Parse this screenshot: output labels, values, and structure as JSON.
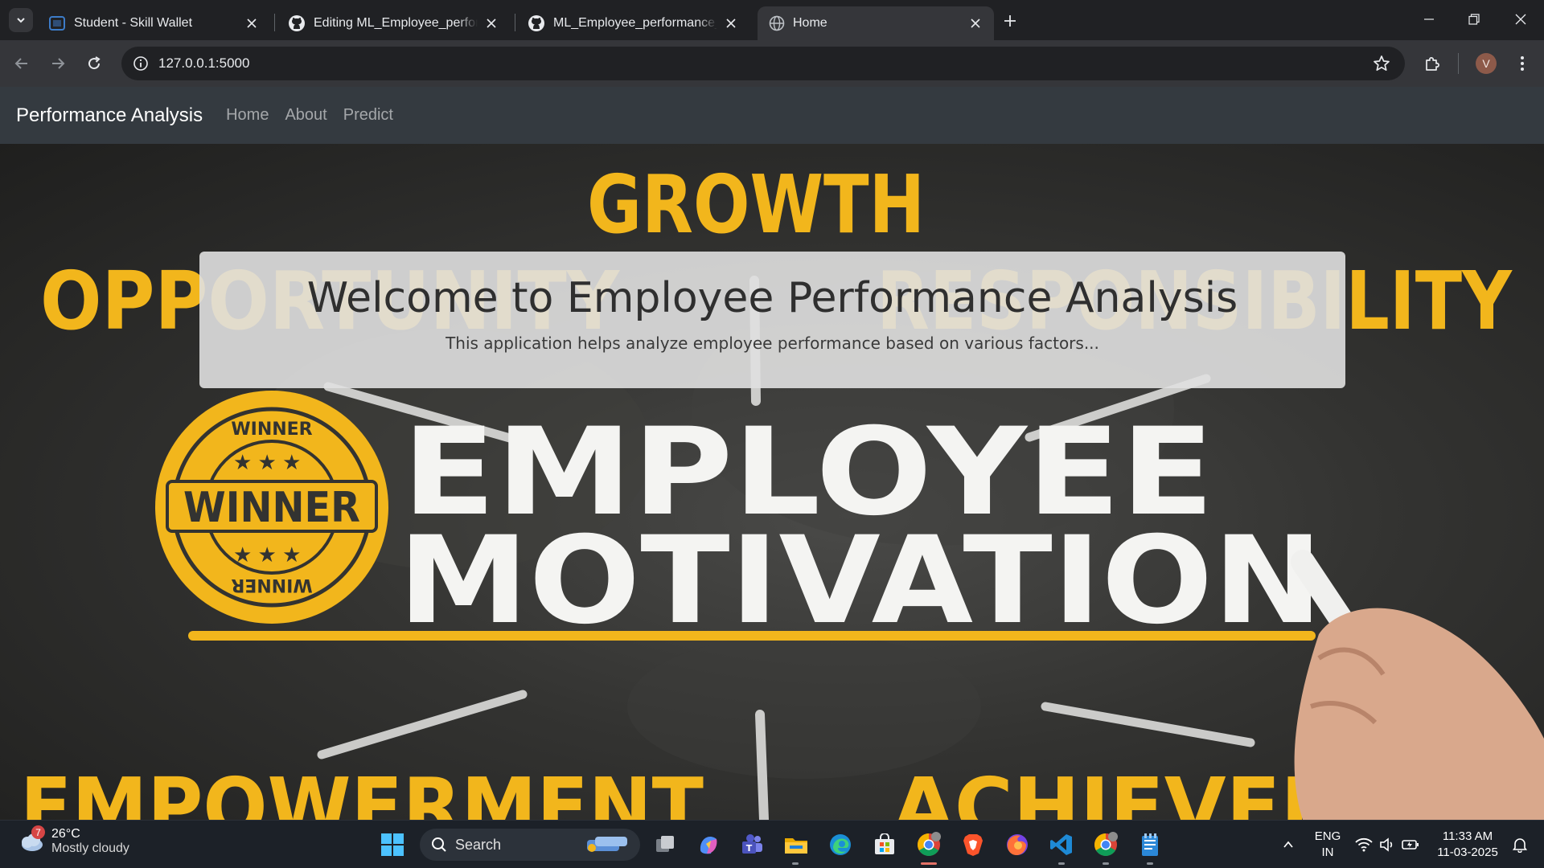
{
  "browser": {
    "tabs": [
      {
        "title": "Student - Skill Wallet",
        "icon": "skill-wallet-icon",
        "active": false
      },
      {
        "title": "Editing ML_Employee_performa",
        "icon": "github-icon",
        "active": false
      },
      {
        "title": "ML_Employee_performance_pre",
        "icon": "github-icon",
        "active": false
      },
      {
        "title": "Home",
        "icon": "globe-icon",
        "active": true
      }
    ],
    "url": "127.0.0.1:5000",
    "profile_initial": "V"
  },
  "site": {
    "brand": "Performance Analysis",
    "nav": [
      "Home",
      "About",
      "Predict"
    ],
    "jumbotron": {
      "heading": "Welcome to Employee Performance Analysis",
      "lead": "This application helps analyze employee performance based on various factors..."
    },
    "hero_image": {
      "words": [
        "GROWTH",
        "OPPORTUNITY",
        "RESPONSIBILITY",
        "EMPLOYEE",
        "MOTIVATION",
        "EMPOWERMENT",
        "ACHIEVEMENT"
      ],
      "badge": {
        "center": "WINNER",
        "top": "WINNER",
        "bottom": "WINNER"
      },
      "colors": {
        "yellow": "#f2b61c",
        "chalk": "#f4f4f2",
        "board": "#333331"
      }
    }
  },
  "taskbar": {
    "weather": {
      "badge": "7",
      "temp": "26°C",
      "condition": "Mostly cloudy"
    },
    "search_label": "Search",
    "language": {
      "line1": "ENG",
      "line2": "IN"
    },
    "clock": {
      "time": "11:33 AM",
      "date": "11-03-2025"
    }
  },
  "colors": {
    "navbar": "#343a40",
    "tab_active": "#35363a",
    "taskbar": "#1c2128"
  }
}
